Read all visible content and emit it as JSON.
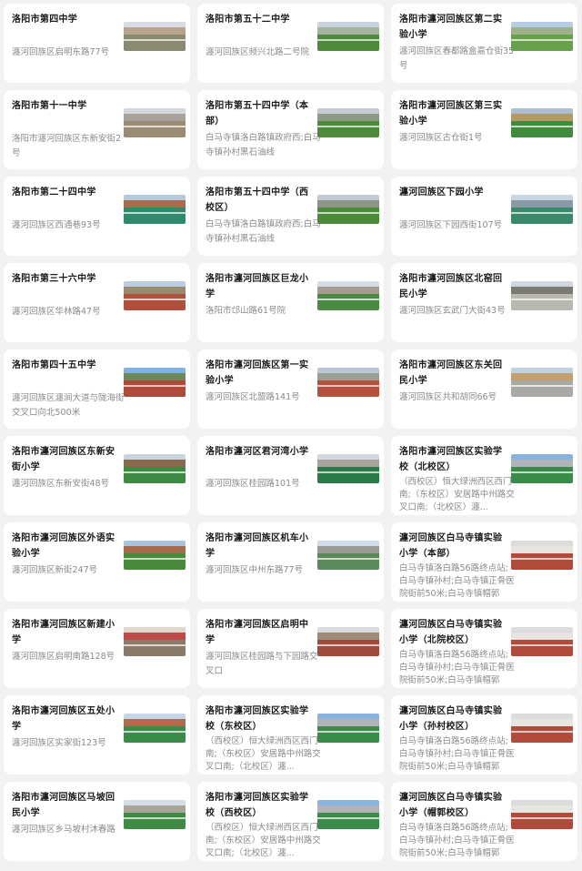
{
  "schools": [
    {
      "name": "洛阳市第四中学",
      "address": "瀍河回族区启明东路77号",
      "thumb": {
        "sky": "#d9dde3",
        "bldg": "#b8a48c",
        "field": "#8a8a6e"
      }
    },
    {
      "name": "洛阳市第五十二中学",
      "address": "瀍河回族区频兴北路二号院",
      "thumb": {
        "sky": "#c9d3de",
        "bldg": "#a8b2a0",
        "field": "#4d8a3c"
      }
    },
    {
      "name": "洛阳市瀍河回族区第二实验小学",
      "address": "瀍河回族区春都路盒嘉仓街35号",
      "thumb": {
        "sky": "#b7cde3",
        "bldg": "#9fb08a",
        "field": "#67a04a"
      }
    },
    {
      "name": "洛阳市第十一中学",
      "address": "洛阳市瀍河回族区东新安街2号",
      "thumb": {
        "sky": "#d2d7dc",
        "bldg": "#a8a39a",
        "field": "#9a8c72"
      }
    },
    {
      "name": "洛阳市第五十四中学（本部）",
      "address": "白马寺镇洛白路镇政府西;白马寺镇孙村黑石油线",
      "thumb": {
        "sky": "#c5ccd6",
        "bldg": "#8d9a86",
        "field": "#4f8a3c"
      }
    },
    {
      "name": "洛阳市瀍河回族区第三实验小学",
      "address": "瀍河回族区古仓街1号",
      "thumb": {
        "sky": "#aebfd3",
        "bldg": "#b29a62",
        "field": "#3f8a3c"
      }
    },
    {
      "name": "洛阳市第二十四中学",
      "address": "瀍河回族区西通巷93号",
      "thumb": {
        "sky": "#b4c9dc",
        "bldg": "#a86b4c",
        "field": "#2e8a6a"
      }
    },
    {
      "name": "洛阳市第五十四中学（西校区）",
      "address": "白马寺镇洛白路镇政府西;白马寺镇孙村黑石油线",
      "thumb": {
        "sky": "#c3cad3",
        "bldg": "#8f9686",
        "field": "#4d8a3c"
      }
    },
    {
      "name": "瀍河回族区下园小学",
      "address": "瀍河回族区下园西街107号",
      "thumb": {
        "sky": "#c9d6e1",
        "bldg": "#8a9aa6",
        "field": "#3a8a6a"
      }
    },
    {
      "name": "洛阳市第三十六中学",
      "address": "瀍河回族区华林路47号",
      "thumb": {
        "sky": "#bccde0",
        "bldg": "#9a8a70",
        "field": "#b0503c"
      }
    },
    {
      "name": "洛阳市瀍河回族区巨龙小学",
      "address": "洛阳市邙山路61号院",
      "thumb": {
        "sky": "#d7dde4",
        "bldg": "#a59d92",
        "field": "#4a8a44"
      }
    },
    {
      "name": "洛阳市瀍河回族区北窑回民小学",
      "address": "瀍河回族区玄武门大街43号",
      "thumb": {
        "sky": "#cfd8e0",
        "bldg": "#7a7a70",
        "field": "#b8b8b0"
      }
    },
    {
      "name": "洛阳市第四十五中学",
      "address": "瀍河回族区瀍涧大道与陇海街交叉口向北500米",
      "thumb": {
        "sky": "#7fb2e0",
        "bldg": "#6a8a5a",
        "field": "#b04a3a"
      }
    },
    {
      "name": "洛阳市瀍河回族区第一实验小学",
      "address": "瀍河回族区北盟路141号",
      "thumb": {
        "sky": "#b9c7d6",
        "bldg": "#9aa094",
        "field": "#b5503c"
      }
    },
    {
      "name": "洛阳市瀍河回族区东关回民小学",
      "address": "瀍河回族区共和胡同66号",
      "thumb": {
        "sky": "#c2d1de",
        "bldg": "#c4a070",
        "field": "#a8a8a4"
      }
    },
    {
      "name": "洛阳市瀍河回族区东新安街小学",
      "address": "瀍河回族区东新安街48号",
      "thumb": {
        "sky": "#c8d4de",
        "bldg": "#8a6a4c",
        "field": "#3e8a44"
      }
    },
    {
      "name": "洛阳市瀍河区君河湾小学",
      "address": "瀍河回族区桂园路101号",
      "thumb": {
        "sky": "#d2d8de",
        "bldg": "#a8a49a",
        "field": "#2a7a4a"
      }
    },
    {
      "name": "洛阳市瀍河回族区实验学校（北校区）",
      "address": "（西校区）恒大绿洲西区西门南;（东校区）安居路中州路交叉口南;（北校区）瀍...",
      "thumb": {
        "sky": "#8ab4e0",
        "bldg": "#b0b4b8",
        "field": "#3a8a4a"
      }
    },
    {
      "name": "洛阳市瀍河回族区外语实验小学",
      "address": "瀍河回族区新街247号",
      "thumb": {
        "sky": "#a9c4de",
        "bldg": "#a46a4c",
        "field": "#4a8a3c"
      }
    },
    {
      "name": "洛阳市瀍河回族区机车小学",
      "address": "瀍河回族区中州东路77号",
      "thumb": {
        "sky": "#cfdbe6",
        "bldg": "#9a9a96",
        "field": "#5a8a5a"
      }
    },
    {
      "name": "瀍河回族区白马寺镇实验小学（本部）",
      "address": "白马寺镇洛白路56路终点站;白马寺镇孙村;白马寺镇正骨医院街前50米;白马寺镇帽郭",
      "thumb": {
        "sky": "#dcdcdc",
        "bldg": "#e8e4e0",
        "field": "#b04a3a"
      }
    },
    {
      "name": "洛阳市瀍河回族区新建小学",
      "address": "瀍河回族区启明南路128号",
      "thumb": {
        "sky": "#e0d8cc",
        "bldg": "#c04a4a",
        "field": "#8a7a6a"
      }
    },
    {
      "name": "洛阳市瀍河回族区启明中学",
      "address": "瀍河回族区桂园路与下园路交叉口",
      "thumb": {
        "sky": "#d8dce0",
        "bldg": "#a08c78",
        "field": "#a04a3c"
      }
    },
    {
      "name": "瀍河回族区白马寺镇实验小学（北院校区）",
      "address": "白马寺镇洛白路56路终点站;白马寺镇孙村;白马寺镇正骨医院街前50米;白马寺镇帽郭",
      "thumb": {
        "sky": "#dcdcdc",
        "bldg": "#e8e4e0",
        "field": "#b04a3a"
      }
    },
    {
      "name": "洛阳市瀍河回族区五处小学",
      "address": "瀍河回族区实家街123号",
      "thumb": {
        "sky": "#c5d6e6",
        "bldg": "#b06a4c",
        "field": "#3a8a4a"
      }
    },
    {
      "name": "洛阳市瀍河回族区实验学校（东校区）",
      "address": "（西校区）恒大绿洲西区西门南;（东校区）安居路中州路交叉口南;（北校区）瀍...",
      "thumb": {
        "sky": "#8ab4e0",
        "bldg": "#b0b4b8",
        "field": "#3a8a4a"
      }
    },
    {
      "name": "瀍河回族区白马寺镇实验小学（孙村校区）",
      "address": "白马寺镇洛白路56路终点站;白马寺镇孙村;白马寺镇正骨医院街前50米;白马寺镇帽郭",
      "thumb": {
        "sky": "#dcdcdc",
        "bldg": "#e8e4e0",
        "field": "#b04a3a"
      }
    },
    {
      "name": "洛阳市瀍河回族区马坡回民小学",
      "address": "瀍河回族区乡马坡村沐春路",
      "thumb": {
        "sky": "#d4dde6",
        "bldg": "#a8a498",
        "field": "#3e8a44"
      }
    },
    {
      "name": "洛阳市瀍河回族区实验学校（西校区）",
      "address": "（西校区）恒大绿洲西区西门南;（东校区）安居路中州路交叉口南;（北校区）瀍...",
      "thumb": {
        "sky": "#8ab4e0",
        "bldg": "#b0b4b8",
        "field": "#3a8a4a"
      }
    },
    {
      "name": "瀍河回族区白马寺镇实验小学（帽郭校区）",
      "address": "白马寺镇洛白路56路终点站;白马寺镇孙村;白马寺镇正骨医院街前50米;白马寺镇帽郭",
      "thumb": {
        "sky": "#dcdcdc",
        "bldg": "#e8e4e0",
        "field": "#b04a3a"
      }
    }
  ]
}
